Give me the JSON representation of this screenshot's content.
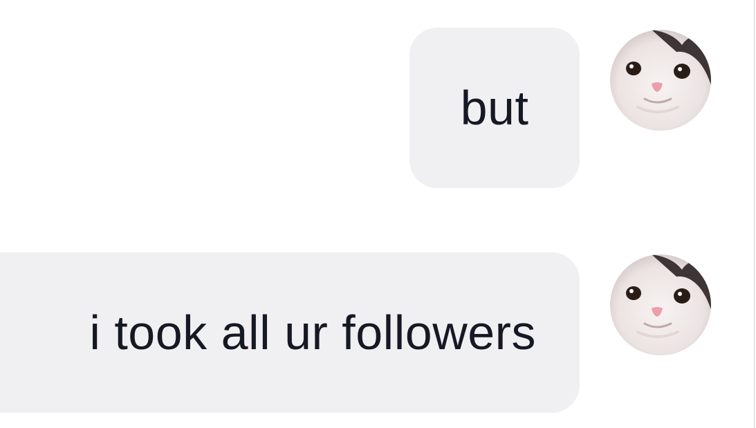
{
  "messages": [
    {
      "text": "but",
      "avatar_icon": "cat-face-icon"
    },
    {
      "text": "i took all ur followers",
      "avatar_icon": "cat-face-icon"
    }
  ],
  "colors": {
    "bubble_background": "#f0f0f2",
    "message_text": "#161823",
    "page_background": "#ffffff"
  }
}
